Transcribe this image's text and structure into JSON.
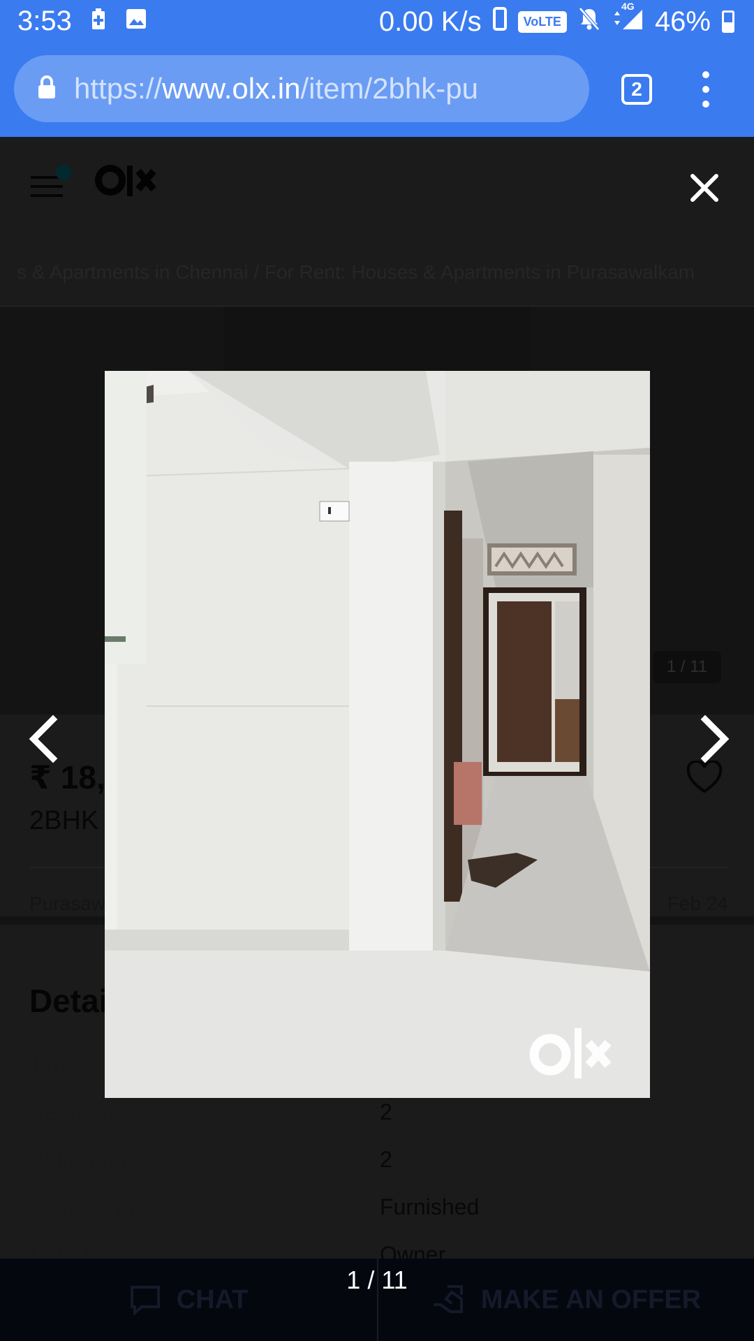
{
  "status_bar": {
    "time": "3:53",
    "net_speed": "0.00 K/s",
    "volte": "VoLTE",
    "network": "4G",
    "battery": "46%"
  },
  "browser": {
    "url_scheme": "https://",
    "url_host": "www.olx.in",
    "url_path": "/item/2bhk-pu",
    "tab_count": "2"
  },
  "page": {
    "breadcrumb": "s & Apartments in Chennai  /  For Rent: Houses & Apartments in Purasawalkam",
    "photo_counter": "1 / 11",
    "price": "₹ 18,",
    "title": "2BHK",
    "location": "Purasaw",
    "date": "Feb 24",
    "details_heading": "Detai",
    "details": [
      {
        "key": "Type",
        "value": ""
      },
      {
        "key": "Bedrooms",
        "value": "2"
      },
      {
        "key": "Bathrooms",
        "value": "2"
      },
      {
        "key": "Furnishing",
        "value": "Furnished"
      },
      {
        "key": "Listed by",
        "value": "Owner"
      }
    ],
    "chat_label": "CHAT",
    "offer_label": "MAKE AN OFFER"
  },
  "gallery": {
    "counter": "1 / 11",
    "watermark": "olx"
  }
}
